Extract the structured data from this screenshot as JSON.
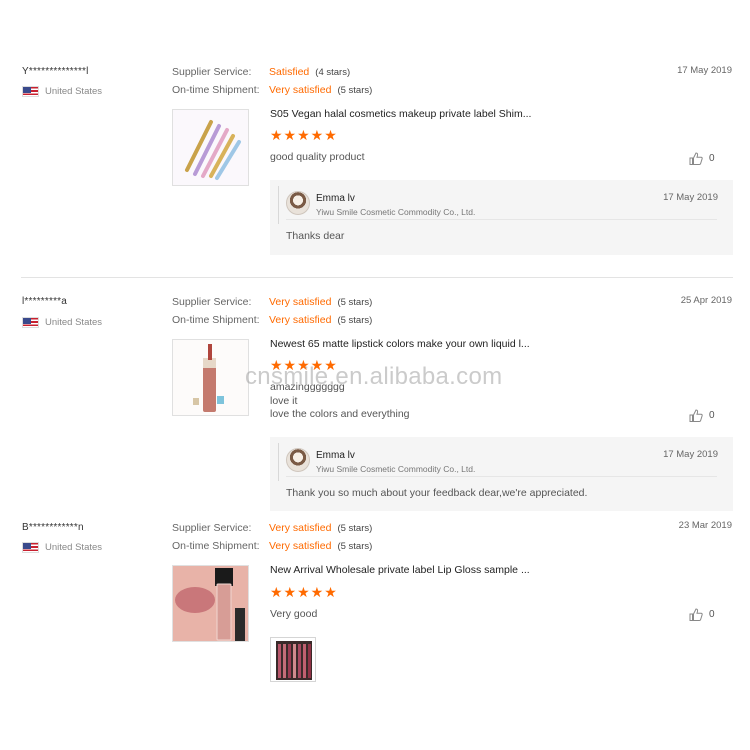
{
  "reviews": [
    {
      "user": "Y**************l",
      "country": "United States",
      "supplier_label": "Supplier Service:",
      "supplier_value": "Satisfied",
      "supplier_stars": "(4 stars)",
      "shipment_label": "On-time Shipment:",
      "shipment_value": "Very satisfied",
      "shipment_stars": "(5 stars)",
      "date": "17 May 2019",
      "product_title": "S05 Vegan halal cosmetics makeup private label Shim...",
      "rating_stars": "★★★★★",
      "comment_lines": [
        "good quality product"
      ],
      "likes": "0",
      "reply": {
        "name": "Emma lv",
        "company": "Yiwu Smile Cosmetic Commodity Co., Ltd.",
        "date": "17 May 2019",
        "text": "Thanks dear"
      }
    },
    {
      "user": "l*********a",
      "country": "United States",
      "supplier_label": "Supplier Service:",
      "supplier_value": "Very satisfied",
      "supplier_stars": "(5 stars)",
      "shipment_label": "On-time Shipment:",
      "shipment_value": "Very satisfied",
      "shipment_stars": "(5 stars)",
      "date": "25 Apr 2019",
      "product_title": "Newest 65 matte lipstick colors make your own liquid l...",
      "rating_stars": "★★★★★",
      "comment_lines": [
        "amazinggggggg",
        "love it",
        "love the colors and everything"
      ],
      "likes": "0",
      "reply": {
        "name": "Emma lv",
        "company": "Yiwu Smile Cosmetic Commodity Co., Ltd.",
        "date": "17 May 2019",
        "text": "Thank you so much about your feedback dear,we're appreciated."
      }
    },
    {
      "user": "B************n",
      "country": "United States",
      "supplier_label": "Supplier Service:",
      "supplier_value": "Very satisfied",
      "supplier_stars": "(5 stars)",
      "shipment_label": "On-time Shipment:",
      "shipment_value": "Very satisfied",
      "shipment_stars": "(5 stars)",
      "date": "23 Mar 2019",
      "product_title": "New Arrival Wholesale private label Lip Gloss sample ...",
      "rating_stars": "★★★★★",
      "comment_lines": [
        "Very good"
      ],
      "likes": "0"
    }
  ],
  "watermark": "cnsmile.en.alibaba.com",
  "colors": {
    "accent": "#ff6a00",
    "reply_bg": "#f5f5f5",
    "divider": "#e3e3e3"
  },
  "icons": {
    "like": "thumbs-up-icon",
    "flag": "us-flag-icon",
    "avatar": "user-avatar"
  }
}
